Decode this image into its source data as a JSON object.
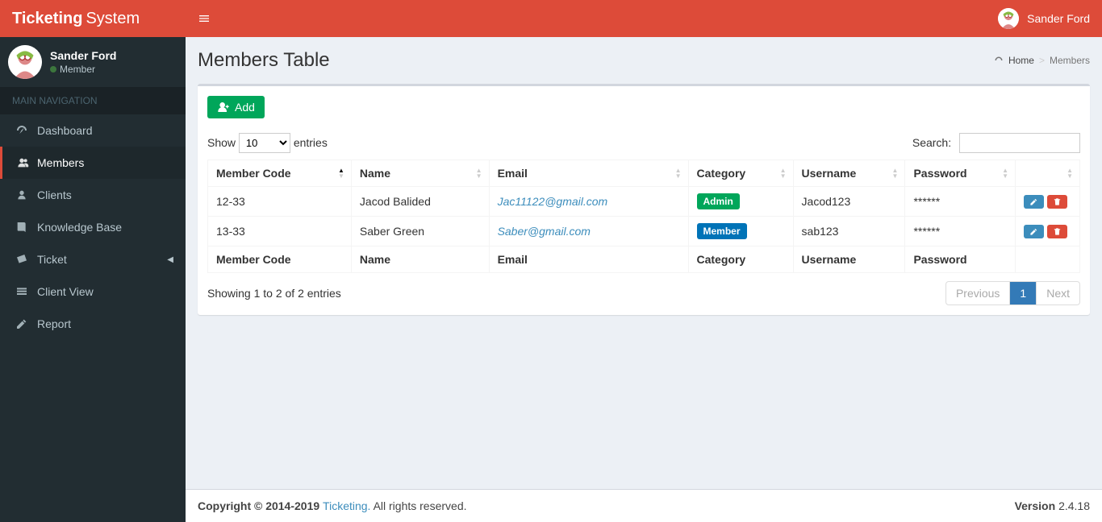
{
  "brand": {
    "bold": "Ticketing",
    "light": "System"
  },
  "header": {
    "user_name": "Sander Ford"
  },
  "sidebar": {
    "user": {
      "name": "Sander Ford",
      "role": "Member"
    },
    "section_header": "MAIN NAVIGATION",
    "items": [
      {
        "label": "Dashboard"
      },
      {
        "label": "Members"
      },
      {
        "label": "Clients"
      },
      {
        "label": "Knowledge Base"
      },
      {
        "label": "Ticket"
      },
      {
        "label": "Client View"
      },
      {
        "label": "Report"
      }
    ]
  },
  "page": {
    "title": "Members Table",
    "breadcrumb_home": "Home",
    "breadcrumb_current": "Members"
  },
  "buttons": {
    "add": "Add",
    "previous": "Previous",
    "next": "Next",
    "page1": "1"
  },
  "datatable": {
    "length": {
      "prefix": "Show",
      "suffix": "entries",
      "value": "10"
    },
    "search_label": "Search:",
    "columns": [
      "Member Code",
      "Name",
      "Email",
      "Category",
      "Username",
      "Password"
    ],
    "rows": [
      {
        "code": "12-33",
        "name": "Jacod Balided",
        "email": "Jac11122@gmail.com",
        "category": "Admin",
        "username": "Jacod123",
        "password": "******"
      },
      {
        "code": "13-33",
        "name": "Saber Green",
        "email": "Saber@gmail.com",
        "category": "Member",
        "username": "sab123",
        "password": "******"
      }
    ],
    "info": "Showing 1 to 2 of 2 entries"
  },
  "footer": {
    "copyright_prefix": "Copyright © 2014-2019 ",
    "brand": "Ticketing.",
    "copyright_suffix": " All rights reserved.",
    "version_label": "Version",
    "version": " 2.4.18"
  }
}
